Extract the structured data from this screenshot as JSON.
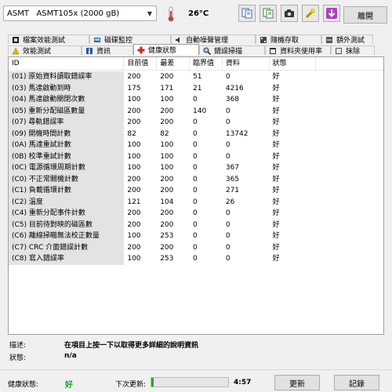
{
  "header": {
    "drive_label": "ASMT   ASMT105x (2000 gB)",
    "temperature": "26°C"
  },
  "toolbar": {
    "exit_label": "離開"
  },
  "tabs_top": [
    {
      "label": "檔案效能測試"
    },
    {
      "label": "磁碟監控"
    },
    {
      "label": "自動噪聲管理"
    },
    {
      "label": "隨機存取"
    },
    {
      "label": "額外測試"
    }
  ],
  "tabs_bottom": [
    {
      "label": "效能測試"
    },
    {
      "label": "資訊"
    },
    {
      "label": "健康狀態"
    },
    {
      "label": "錯誤掃描"
    },
    {
      "label": "資料夾使用率"
    },
    {
      "label": "抹除"
    }
  ],
  "table": {
    "headers": [
      "ID",
      "目前值",
      "最差",
      "臨界值",
      "資料",
      "狀態"
    ],
    "rows": [
      {
        "id": "(01) 原始資料讀取錯誤率",
        "current": "200",
        "worst": "200",
        "threshold": "51",
        "data": "0",
        "status": "好"
      },
      {
        "id": "(03) 馬達啟動到時",
        "current": "175",
        "worst": "171",
        "threshold": "21",
        "data": "4216",
        "status": "好"
      },
      {
        "id": "(04) 馬達啟動關閉次數",
        "current": "100",
        "worst": "100",
        "threshold": "0",
        "data": "368",
        "status": "好"
      },
      {
        "id": "(05) 重新分配磁區數量",
        "current": "200",
        "worst": "200",
        "threshold": "140",
        "data": "0",
        "status": "好"
      },
      {
        "id": "(07) 尋軌錯誤率",
        "current": "200",
        "worst": "200",
        "threshold": "0",
        "data": "0",
        "status": "好"
      },
      {
        "id": "(09) 開機時間計數",
        "current": "82",
        "worst": "82",
        "threshold": "0",
        "data": "13742",
        "status": "好"
      },
      {
        "id": "(0A) 馬達重試計數",
        "current": "100",
        "worst": "100",
        "threshold": "0",
        "data": "0",
        "status": "好"
      },
      {
        "id": "(0B) 校準重試計數",
        "current": "100",
        "worst": "100",
        "threshold": "0",
        "data": "0",
        "status": "好"
      },
      {
        "id": "(0C) 電源循環周期計數",
        "current": "100",
        "worst": "100",
        "threshold": "0",
        "data": "367",
        "status": "好"
      },
      {
        "id": "(C0) 不正常關機計數",
        "current": "200",
        "worst": "200",
        "threshold": "0",
        "data": "365",
        "status": "好"
      },
      {
        "id": "(C1) 負載循環計數",
        "current": "200",
        "worst": "200",
        "threshold": "0",
        "data": "271",
        "status": "好"
      },
      {
        "id": "(C2) 溫度",
        "current": "121",
        "worst": "104",
        "threshold": "0",
        "data": "26",
        "status": "好"
      },
      {
        "id": "(C4) 重新分配事件計數",
        "current": "200",
        "worst": "200",
        "threshold": "0",
        "data": "0",
        "status": "好"
      },
      {
        "id": "(C5) 目前待對映的磁區數",
        "current": "200",
        "worst": "200",
        "threshold": "0",
        "data": "0",
        "status": "好"
      },
      {
        "id": "(C6) 離線掃瞄無法校正數量",
        "current": "100",
        "worst": "253",
        "threshold": "0",
        "data": "0",
        "status": "好"
      },
      {
        "id": "(C7) CRC 介面錯誤計數",
        "current": "200",
        "worst": "200",
        "threshold": "0",
        "data": "0",
        "status": "好"
      },
      {
        "id": "(C8) 寫入錯誤率",
        "current": "100",
        "worst": "253",
        "threshold": "0",
        "data": "0",
        "status": "好"
      }
    ]
  },
  "info": {
    "description_label": "描述:",
    "description_value": "在項目上按一下以取得更多詳細的說明資訊",
    "status_label": "狀態:",
    "status_value": "n/a"
  },
  "footer": {
    "health_label": "健康狀態:",
    "health_value": "好",
    "next_update_label": "下次更新:",
    "progress_fraction": 0.03,
    "next_update_time": "4:57",
    "refresh_label": "更新",
    "log_label": "記錄"
  },
  "colors": {
    "health_good": "#1a9a1a",
    "progress_fill": "#06b025"
  }
}
